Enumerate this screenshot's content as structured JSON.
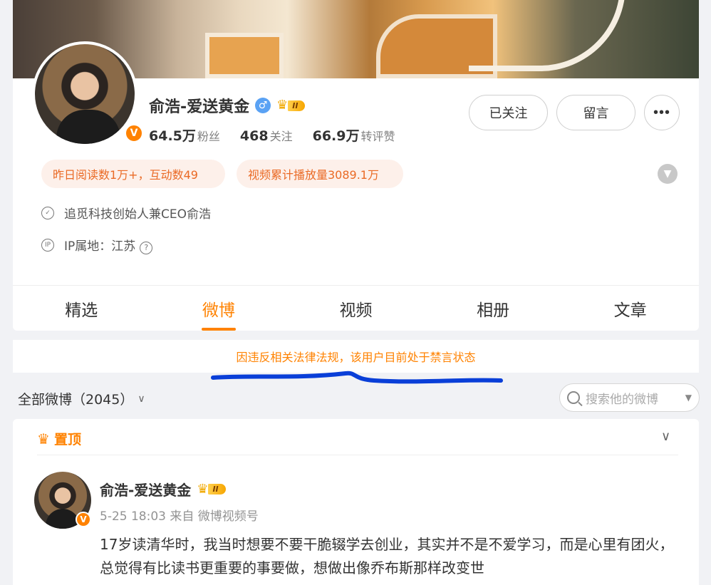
{
  "profile": {
    "name": "俞浩-爱送黄金",
    "gender_symbol": "♂",
    "vip_level": "II",
    "verified_mark": "V",
    "stats": [
      {
        "num": "64.5万",
        "label": "粉丝"
      },
      {
        "num": "468",
        "label": "关注"
      },
      {
        "num": "66.9万",
        "label": "转评赞"
      }
    ],
    "buttons": {
      "follow": "已关注",
      "message": "留言",
      "more": "•••"
    },
    "tags": [
      "昨日阅读数1万+，互动数49",
      "视频累计播放量3089.1万"
    ],
    "verification": "追觅科技创始人兼CEO俞浩",
    "ip_location": "IP属地：江苏",
    "help_symbol": "?",
    "ip_icon_text": "IP"
  },
  "tabs": [
    {
      "label": "精选",
      "active": false
    },
    {
      "label": "微博",
      "active": true
    },
    {
      "label": "视频",
      "active": false
    },
    {
      "label": "相册",
      "active": false
    },
    {
      "label": "文章",
      "active": false
    }
  ],
  "notice": "因违反相关法律法规，该用户目前处于禁言状态",
  "filter": {
    "label": "全部微博（2045）",
    "chevron": "∨"
  },
  "search": {
    "placeholder": "搜索他的微博"
  },
  "pinned_post": {
    "pin_label": "置顶",
    "author": "俞浩-爱送黄金",
    "vip_level": "II",
    "meta": "5-25 18:03  来自 微博视频号",
    "text": "17岁读清华时，我当时想要不要干脆辍学去创业，其实并不是不爱学习，而是心里有团火，总觉得有比读书更重要的事要做，想做出像乔布斯那样改变世"
  },
  "colors": {
    "accent": "#ff8200",
    "tag_bg": "#fdf0ea",
    "tag_text": "#ea6a25",
    "scribble": "#0a3fd8"
  }
}
